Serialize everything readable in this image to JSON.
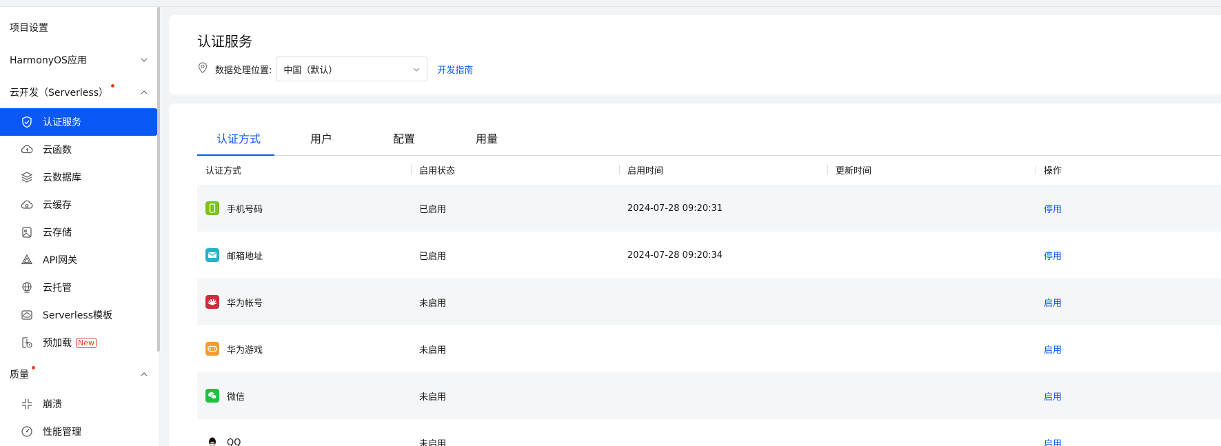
{
  "sidebar": {
    "project_settings": "项目设置",
    "group_harmony": "HarmonyOS应用",
    "group_serverless": "云开发（Serverless）",
    "items": [
      {
        "label": "认证服务",
        "icon": "shield-check-icon",
        "active": true
      },
      {
        "label": "云函数",
        "icon": "cloud-function-icon"
      },
      {
        "label": "云数据库",
        "icon": "database-layers-icon"
      },
      {
        "label": "云缓存",
        "icon": "cloud-cache-icon"
      },
      {
        "label": "云存储",
        "icon": "cloud-storage-icon"
      },
      {
        "label": "API网关",
        "icon": "api-gateway-icon"
      },
      {
        "label": "云托管",
        "icon": "globe-icon"
      },
      {
        "label": "Serverless模板",
        "icon": "cloud-template-icon"
      },
      {
        "label": "预加载",
        "icon": "preload-icon",
        "badge": "New"
      }
    ],
    "group_quality": "质量",
    "quality_items": [
      {
        "label": "崩溃",
        "icon": "crash-icon"
      },
      {
        "label": "性能管理",
        "icon": "gauge-icon"
      }
    ]
  },
  "header": {
    "title": "认证服务",
    "location_label": "数据处理位置:",
    "location_value": "中国（默认）",
    "dev_guide": "开发指南"
  },
  "tabs": [
    "认证方式",
    "用户",
    "配置",
    "用量"
  ],
  "table": {
    "columns": [
      "认证方式",
      "启用状态",
      "启用时间",
      "更新时间",
      "操作"
    ],
    "rows": [
      {
        "method": "手机号码",
        "status": "已启用",
        "enabled_time": "2024-07-28 09:20:31",
        "updated_time": "",
        "action": "停用",
        "icon": "phone-icon",
        "icon_color": "#7cc41b"
      },
      {
        "method": "邮箱地址",
        "status": "已启用",
        "enabled_time": "2024-07-28 09:20:34",
        "updated_time": "",
        "action": "停用",
        "icon": "mail-icon",
        "icon_color": "#1fb5c9"
      },
      {
        "method": "华为帐号",
        "status": "未启用",
        "enabled_time": "",
        "updated_time": "",
        "action": "启用",
        "icon": "huawei-icon",
        "icon_color": "#c7313d"
      },
      {
        "method": "华为游戏",
        "status": "未启用",
        "enabled_time": "",
        "updated_time": "",
        "action": "启用",
        "icon": "gamepad-icon",
        "icon_color": "#f29c38"
      },
      {
        "method": "微信",
        "status": "未启用",
        "enabled_time": "",
        "updated_time": "",
        "action": "启用",
        "icon": "wechat-icon",
        "icon_color": "#1fc23c"
      },
      {
        "method": "QQ",
        "status": "未启用",
        "enabled_time": "",
        "updated_time": "",
        "action": "启用",
        "icon": "qq-icon",
        "icon_color": "#111111"
      }
    ]
  }
}
